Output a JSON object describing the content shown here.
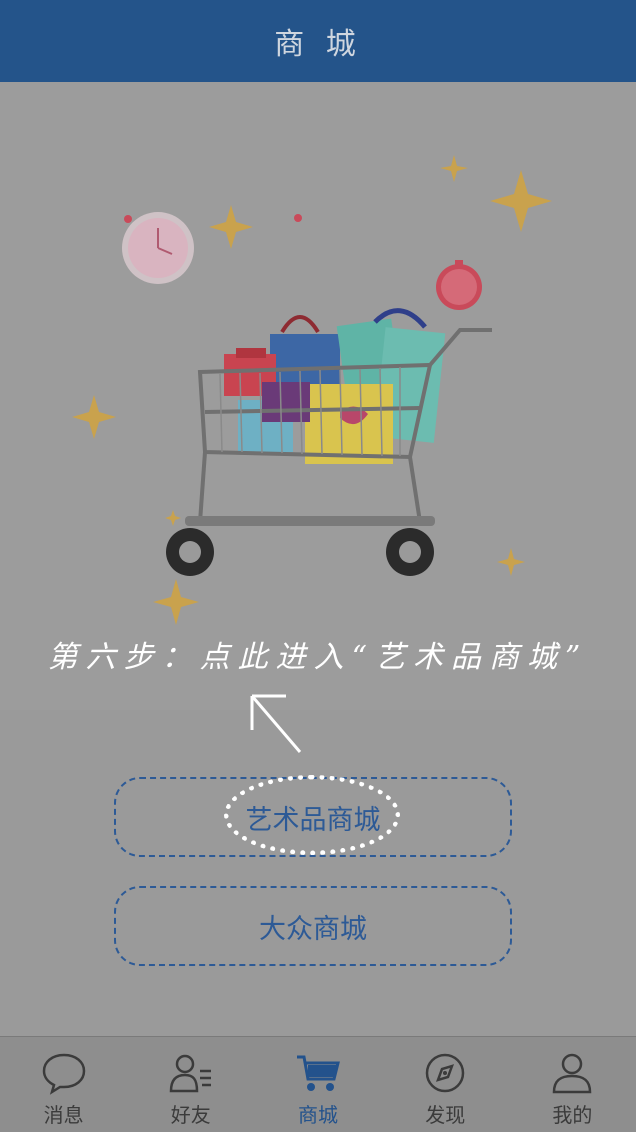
{
  "header": {
    "title": "商 城"
  },
  "hero": {
    "instruction": "第六步：点此进入“艺术品商城”"
  },
  "buttons": {
    "art_mall": "艺术品商城",
    "public_mall": "大众商城"
  },
  "nav": {
    "items": [
      {
        "label": "消息",
        "icon": "chat-bubble-icon",
        "active": false
      },
      {
        "label": "好友",
        "icon": "friends-icon",
        "active": false
      },
      {
        "label": "商城",
        "icon": "cart-icon",
        "active": true
      },
      {
        "label": "发现",
        "icon": "compass-icon",
        "active": false
      },
      {
        "label": "我的",
        "icon": "person-icon",
        "active": false
      }
    ]
  },
  "colors": {
    "header_bg": "#24548a",
    "accent": "#2d5a96",
    "overlay_bg": "#9c9c9c"
  }
}
